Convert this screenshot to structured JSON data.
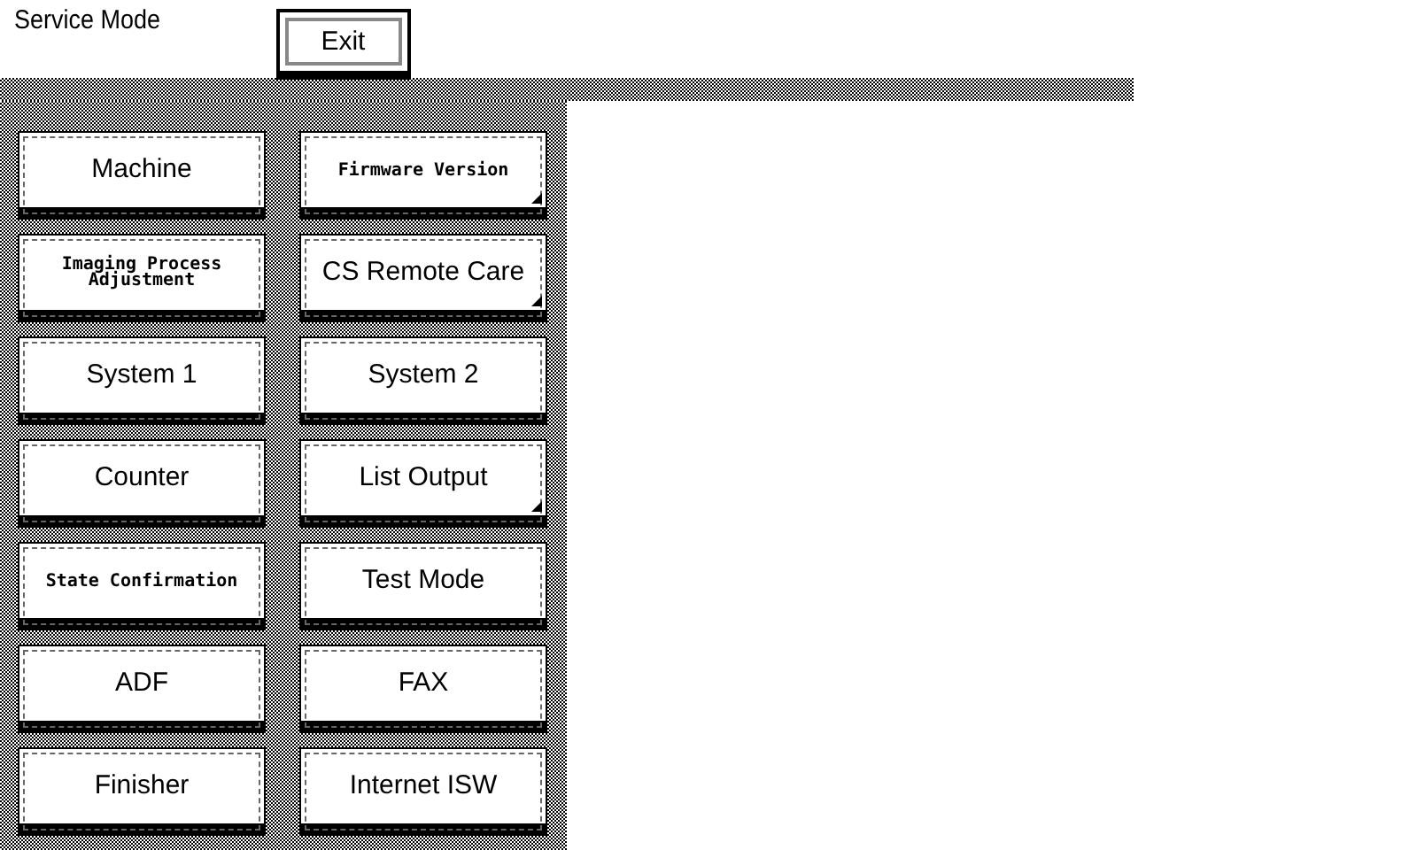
{
  "title": "Service Mode",
  "exit_button": "Exit",
  "buttons": [
    {
      "label": "Machine",
      "kind": "normal",
      "submenu": false
    },
    {
      "label": "Firmware Version",
      "kind": "compact",
      "submenu": true
    },
    {
      "label": "Imaging Process Adjustment",
      "kind": "compact",
      "submenu": false
    },
    {
      "label": "CS Remote Care",
      "kind": "normal",
      "submenu": true
    },
    {
      "label": "System 1",
      "kind": "normal",
      "submenu": false
    },
    {
      "label": "System 2",
      "kind": "normal",
      "submenu": false
    },
    {
      "label": "Counter",
      "kind": "normal",
      "submenu": false
    },
    {
      "label": "List Output",
      "kind": "normal",
      "submenu": true
    },
    {
      "label": "State Confirmation",
      "kind": "compact",
      "submenu": false
    },
    {
      "label": "Test Mode",
      "kind": "normal",
      "submenu": false
    },
    {
      "label": "ADF",
      "kind": "normal",
      "submenu": false
    },
    {
      "label": "FAX",
      "kind": "normal",
      "submenu": false
    },
    {
      "label": "Finisher",
      "kind": "normal",
      "submenu": false
    },
    {
      "label": "Internet ISW",
      "kind": "normal",
      "submenu": false
    }
  ]
}
